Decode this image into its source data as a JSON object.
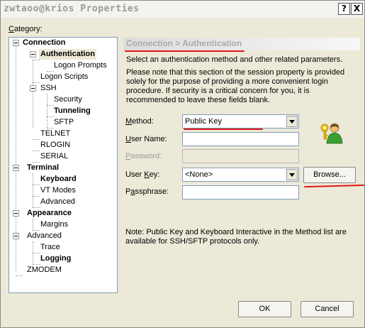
{
  "window": {
    "title": "zwtaoo@krios Properties",
    "help_button": "?",
    "close_button": "X"
  },
  "category_label_prefix": "",
  "category_label_accel": "C",
  "category_label_rest": "ategory:",
  "tree": [
    {
      "label": "Connection",
      "bold": true
    },
    {
      "label": "Authentication",
      "bold": true
    },
    {
      "label": "Logon Prompts",
      "bold": false
    },
    {
      "label": "Logon Scripts",
      "bold": false
    },
    {
      "label": "SSH",
      "bold": false
    },
    {
      "label": "Security",
      "bold": false
    },
    {
      "label": "Tunneling",
      "bold": true
    },
    {
      "label": "SFTP",
      "bold": false
    },
    {
      "label": "TELNET",
      "bold": false
    },
    {
      "label": "RLOGIN",
      "bold": false
    },
    {
      "label": "SERIAL",
      "bold": false
    },
    {
      "label": "Terminal",
      "bold": true
    },
    {
      "label": "Keyboard",
      "bold": true
    },
    {
      "label": "VT Modes",
      "bold": false
    },
    {
      "label": "Advanced",
      "bold": false
    },
    {
      "label": "Appearance",
      "bold": true
    },
    {
      "label": "Margins",
      "bold": false
    },
    {
      "label": "Advanced",
      "bold": false
    },
    {
      "label": "Trace",
      "bold": false
    },
    {
      "label": "Logging",
      "bold": true
    },
    {
      "label": "ZMODEM",
      "bold": false
    }
  ],
  "panel": {
    "header": "Connection > Authentication",
    "description1": "Select an authentication method and other related parameters.",
    "description2": "Please note that this section of the session property is provided solely for the purpose of providing a more convenient login procedure. If security is a critical concern for you, it is recommended to leave these fields blank.",
    "method_label_accel": "M",
    "method_label_rest": "ethod:",
    "method_value": "Public Key",
    "username_label_accel": "U",
    "username_label_rest": "ser Name:",
    "username_value": "",
    "password_label_accel": "P",
    "password_label_rest": "assword:",
    "password_value": "",
    "userkey_label_pre": "User ",
    "userkey_label_accel": "K",
    "userkey_label_rest": "ey:",
    "userkey_value": "<None>",
    "browse_label": "Browse...",
    "passphrase_label_pre": "P",
    "passphrase_label_accel": "a",
    "passphrase_label_rest": "ssphrase:",
    "passphrase_value": "",
    "note": "Note: Public Key and Keyboard Interactive in the Method list are available for SSH/SFTP protocols only."
  },
  "buttons": {
    "ok": "OK",
    "cancel": "Cancel"
  },
  "colors": {
    "annotation_red": "#e01818",
    "dialog_bg": "#ece9d8"
  },
  "icons": {
    "user_key": "user-with-key-icon"
  }
}
